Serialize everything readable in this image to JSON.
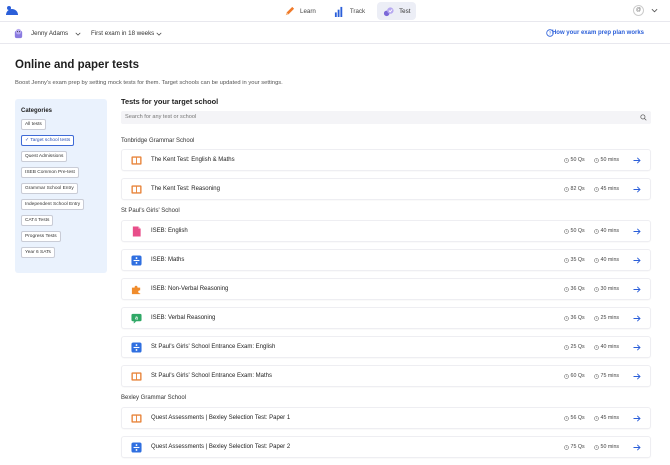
{
  "nav": {
    "tabs": [
      {
        "label": "Learn",
        "icon": "pencil-icon",
        "active": false
      },
      {
        "label": "Track",
        "icon": "bar-chart-icon",
        "active": false
      },
      {
        "label": "Test",
        "icon": "test-icon",
        "active": true
      }
    ],
    "avatar_initial": "@"
  },
  "subbar": {
    "child_name": "Jenny Adams",
    "exam_when": "First exam in 18 weeks",
    "help_link": "How your exam prep plan works"
  },
  "page": {
    "title": "Online and paper tests",
    "subtitle": "Boost Jenny's exam prep by setting mock tests for them. Target schools can be updated in your settings."
  },
  "sidebar": {
    "title": "Categories",
    "items": [
      {
        "label": "All tests"
      },
      {
        "label": "✓ Target school tests"
      },
      {
        "label": "Quest Admissions"
      },
      {
        "label": "ISEB Common Pre-test"
      },
      {
        "label": "Grammar School Entry"
      },
      {
        "label": "Independent School Entry"
      },
      {
        "label": "CAT4 Tests"
      },
      {
        "label": "Progress Tests"
      },
      {
        "label": "Year 6 SATs"
      }
    ]
  },
  "main": {
    "title": "Tests for your target school",
    "search_placeholder": "Search for any test or school",
    "groups": [
      {
        "name": "Tonbridge Grammar School",
        "tests": [
          {
            "name": "The Kent Test: English & Maths",
            "qs": "50 Qs",
            "mins": "50 mins",
            "icon": "book-icon"
          },
          {
            "name": "The Kent Test: Reasoning",
            "qs": "82 Qs",
            "mins": "45 mins",
            "icon": "book-icon"
          }
        ]
      },
      {
        "name": "St Paul's Girls' School",
        "tests": [
          {
            "name": "ISEB: English",
            "qs": "50 Qs",
            "mins": "40 mins",
            "icon": "document-icon"
          },
          {
            "name": "ISEB: Maths",
            "qs": "35 Qs",
            "mins": "40 mins",
            "icon": "divide-icon"
          },
          {
            "name": "ISEB: Non-Verbal Reasoning",
            "qs": "36 Qs",
            "mins": "30 mins",
            "icon": "puzzle-icon"
          },
          {
            "name": "ISEB: Verbal Reasoning",
            "qs": "36 Qs",
            "mins": "25 mins",
            "icon": "speech-icon"
          },
          {
            "name": "St Paul's Girls' School Entrance Exam: English",
            "qs": "25 Qs",
            "mins": "40 mins",
            "icon": "divide-icon"
          },
          {
            "name": "St Paul's Girls' School Entrance Exam: Maths",
            "qs": "60 Qs",
            "mins": "75 mins",
            "icon": "book-icon"
          }
        ]
      },
      {
        "name": "Bexley Grammar School",
        "tests": [
          {
            "name": "Quest Assessments | Bexley Selection Test: Paper 1",
            "qs": "56 Qs",
            "mins": "45 mins",
            "icon": "book-icon"
          },
          {
            "name": "Quest Assessments | Bexley Selection Test: Paper 2",
            "qs": "75 Qs",
            "mins": "50 mins",
            "icon": "divide-icon"
          }
        ]
      }
    ]
  },
  "colors": {
    "accent": "#2b5fd9",
    "book": "#e8843a",
    "document": "#e84e8a",
    "divide": "#2f6fe0",
    "puzzle": "#f08c2c",
    "speech": "#2fa866",
    "sidebar_bg": "#eaf2fd"
  }
}
